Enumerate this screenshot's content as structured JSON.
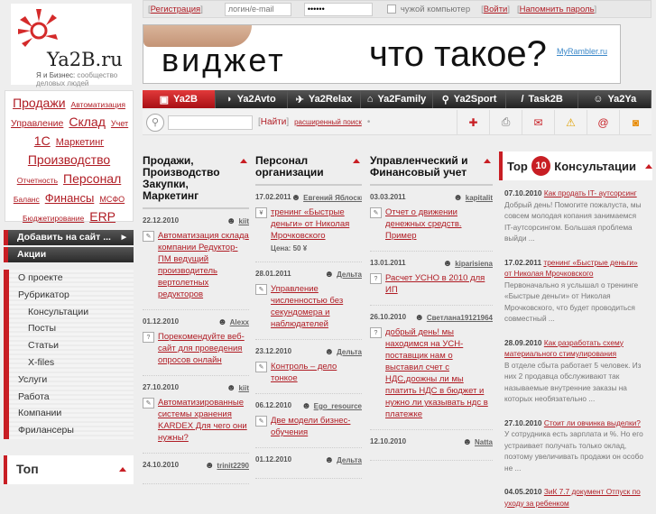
{
  "logo": {
    "name": "Ya2B.ru",
    "tagline_bold": "Я и Бизнес:",
    "tagline": "сообщество деловых людей"
  },
  "topbar": {
    "register": "Регистрация",
    "login_placeholder": "логин/e-mail",
    "password_value": "••••••",
    "foreign_pc": "чужой компьютер",
    "login": "Войти",
    "remind": "Напомнить пароль"
  },
  "banner": {
    "word": "виджет",
    "question": "что такое?",
    "link": "MyRambler.ru"
  },
  "tabs": [
    {
      "label": "Ya2B",
      "icon": "briefcase-icon"
    },
    {
      "label": "Ya2Avto",
      "icon": "car-icon"
    },
    {
      "label": "Ya2Relax",
      "icon": "plane-icon"
    },
    {
      "label": "Ya2Family",
      "icon": "house-icon"
    },
    {
      "label": "Ya2Sport",
      "icon": "runner-icon"
    },
    {
      "label": "Task2B",
      "icon": "feather-icon"
    },
    {
      "label": "Ya2Ya",
      "icon": "user-icon"
    }
  ],
  "search": {
    "find": "Найти",
    "advanced": "расширенный поиск"
  },
  "tags": [
    "Продажи",
    "Автоматизация",
    "Управление",
    "Склад",
    "Учет",
    "1С",
    "Маркетинг",
    "Производство",
    "Отчетность",
    "Персонал",
    "Баланс",
    "Финансы",
    "МСФО",
    "Бюджетирование",
    "ERP"
  ],
  "leftmenu": {
    "add": "Добавить на сайт ...",
    "promo": "Акции",
    "items": [
      "О проекте",
      "Рубрикатор",
      "Консультации",
      "Посты",
      "Статьи",
      "X-files",
      "Услуги",
      "Работа",
      "Компании",
      "Фрилансеры"
    ],
    "top": "Топ"
  },
  "columns": [
    {
      "title": "Продажи, Производство Закупки, Маркетинг",
      "items": [
        {
          "date": "22.12.2010",
          "author": "kiit",
          "title": "Автоматизация склада компании Редуктор-ПМ ведущий производитель вертолетных редукторов",
          "type": "article"
        },
        {
          "date": "01.12.2010",
          "author": "Alexx",
          "title": "Порекомендуйте веб-сайт для проведения опросов онлайн",
          "type": "question"
        },
        {
          "date": "27.10.2010",
          "author": "kiit",
          "title": "Автоматизированные системы хранения KARDEX Для чего они нужны?",
          "type": "article"
        },
        {
          "date": "24.10.2010",
          "author": "trinit2290",
          "title": "",
          "type": "article"
        }
      ]
    },
    {
      "title": "Персонал организации",
      "items": [
        {
          "date": "17.02.2011",
          "author": "Евгений Яблоcкин",
          "title": "тренинг «Быстрые деньги» от Николая Мрочковского",
          "type": "yen",
          "price_label": "Цена:",
          "price": "50 ¥"
        },
        {
          "date": "28.01.2011",
          "author": "Дельта",
          "title": "Управление численностью без секундомера и наблюдателей",
          "type": "article"
        },
        {
          "date": "23.12.2010",
          "author": "Дельта",
          "title": "Контроль – дело тонкое",
          "type": "article"
        },
        {
          "date": "06.12.2010",
          "author": "Ego_resource",
          "title": "Две модели бизнес-обучения",
          "type": "article"
        },
        {
          "date": "01.12.2010",
          "author": "Дельта",
          "title": "",
          "type": "article"
        }
      ]
    },
    {
      "title": "Управленческий и Финансовый учет",
      "items": [
        {
          "date": "03.03.2011",
          "author": "kapitalit",
          "title": "Отчет о движении денежных средств. Пример",
          "type": "article"
        },
        {
          "date": "13.01.2011",
          "author": "kiparisiena",
          "title": "Расчет УСНО в 2010 для ИП",
          "type": "question"
        },
        {
          "date": "26.10.2010",
          "author": "Светлана19121964",
          "title": "добрый день! мы находимся на УСН-поставщик нам о выставил счет с НДС,доожны ли мы платить НДС в бюджет и нужно ли указывать ндс в платежке",
          "type": "question"
        },
        {
          "date": "12.10.2010",
          "author": "Natta",
          "title": "",
          "type": "question"
        }
      ]
    }
  ],
  "top10": {
    "top": "Top",
    "num": "10",
    "title": "Консультации",
    "items": [
      {
        "date": "07.10.2010",
        "title": "Как продать IT- аутсорсинг",
        "text": "Добрый день! Помогите пожалуста, мы совсем молодая копания занимаемся IT-аутсорсингом. Большая проблема выйди ..."
      },
      {
        "date": "17.02.2011",
        "title": "тренинг «Быстрые деньги» от Николая Мрочковского",
        "text": "Первоначально я услышал о тренинге «Быстрые деньги» от Николая Мрочковского, что будет проводиться совместный ..."
      },
      {
        "date": "28.09.2010",
        "title": "Как разработать схему материального стимулирования",
        "text": "В отделе сбыта работает 5 человек. Из них 2 продавца обслуживают так называемые внутренние заказы на которых необязательно ..."
      },
      {
        "date": "27.10.2010",
        "title": "Стоит ли овчинка выделки?",
        "text": "У сотрудника есть зарплата и %. Но его устраивает получать только оклад, поэтому увеличивать продажи он особо не ..."
      },
      {
        "date": "04.05.2010",
        "title": "ЗиК 7.7 документ Отпуск по уходу за ребенком",
        "text": ""
      }
    ]
  }
}
